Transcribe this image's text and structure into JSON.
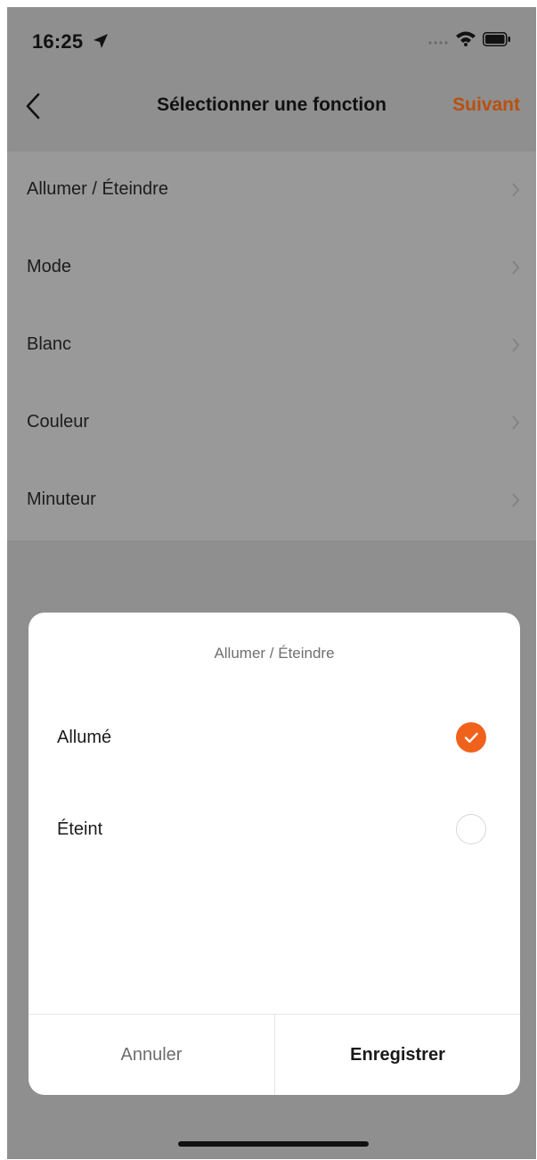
{
  "status_bar": {
    "time": "16:25",
    "icons": [
      "location-arrow-icon",
      "signal-icon",
      "wifi-icon",
      "battery-icon"
    ]
  },
  "nav": {
    "back_icon": "chevron-left-icon",
    "title": "Sélectionner une fonction",
    "next_label": "Suivant"
  },
  "functions": [
    {
      "label": "Allumer / Éteindre"
    },
    {
      "label": "Mode"
    },
    {
      "label": "Blanc"
    },
    {
      "label": "Couleur"
    },
    {
      "label": "Minuteur"
    }
  ],
  "dialog": {
    "title": "Allumer / Éteindre",
    "options": [
      {
        "label": "Allumé",
        "selected": true
      },
      {
        "label": "Éteint",
        "selected": false
      }
    ],
    "cancel_label": "Annuler",
    "save_label": "Enregistrer"
  },
  "colors": {
    "accent": "#f0621c",
    "nav_next": "#b9500f",
    "overlay": "#8f8f8f"
  }
}
